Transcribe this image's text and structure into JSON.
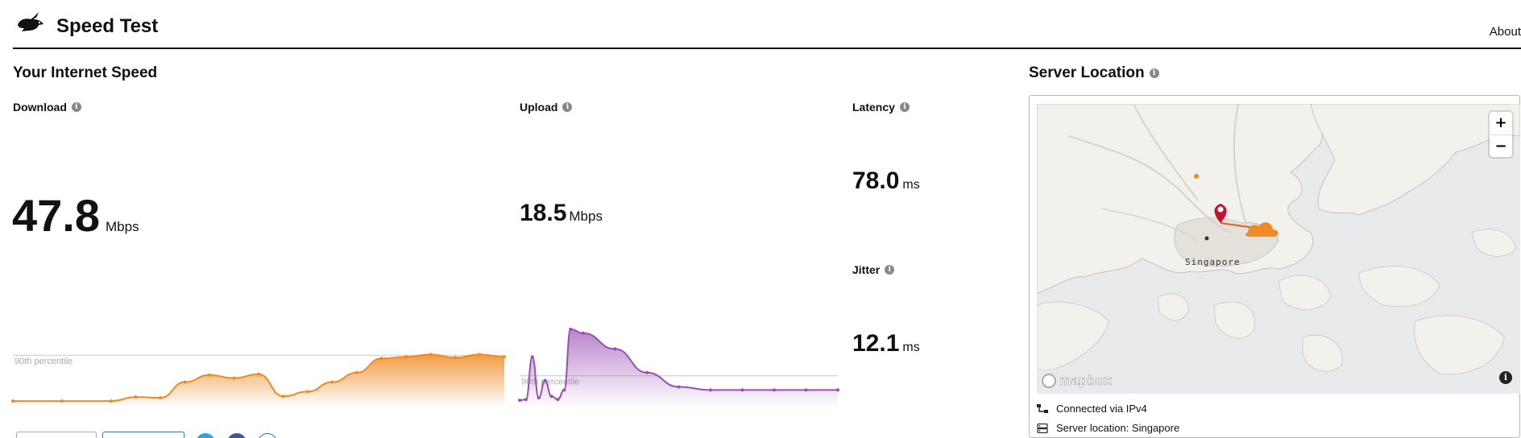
{
  "header": {
    "title": "Speed Test",
    "about_label": "About"
  },
  "speed_section": {
    "title": "Your Internet Speed"
  },
  "download": {
    "label": "Download",
    "value": "47.8",
    "unit": "Mbps",
    "percentile_label": "90th percentile",
    "color": "#f08a24"
  },
  "upload": {
    "label": "Upload",
    "value": "18.5",
    "unit": "Mbps",
    "percentile_label": "90th percentile",
    "color": "#9a4fb3"
  },
  "latency": {
    "label": "Latency",
    "value": "78.0",
    "unit": "ms"
  },
  "jitter": {
    "label": "Jitter",
    "value": "12.1",
    "unit": "ms"
  },
  "server": {
    "title": "Server Location",
    "map_city_label": "Singapore",
    "map_brand": "mapbox",
    "zoom_in": "+",
    "zoom_out": "−",
    "connection": "Connected via IPv4",
    "location": "Server location: Singapore"
  },
  "chart_data": [
    {
      "type": "area",
      "name": "download",
      "x": [
        0,
        10,
        20,
        25,
        30,
        35,
        40,
        45,
        50,
        55,
        60,
        65,
        70,
        75,
        80,
        85,
        90,
        95,
        100
      ],
      "values": [
        4,
        4,
        4,
        9,
        8,
        28,
        37,
        33,
        38,
        10,
        16,
        28,
        40,
        58,
        60,
        63,
        59,
        63,
        60
      ],
      "threshold": 62
    },
    {
      "type": "area",
      "name": "upload",
      "x": [
        0,
        2,
        4,
        6,
        8,
        10,
        12,
        14,
        16,
        20,
        30,
        40,
        50,
        60,
        70,
        80,
        90,
        100
      ],
      "values": [
        5,
        6,
        60,
        8,
        30,
        10,
        6,
        18,
        95,
        90,
        70,
        40,
        22,
        18,
        18,
        18,
        18,
        18
      ],
      "threshold": 36
    }
  ]
}
